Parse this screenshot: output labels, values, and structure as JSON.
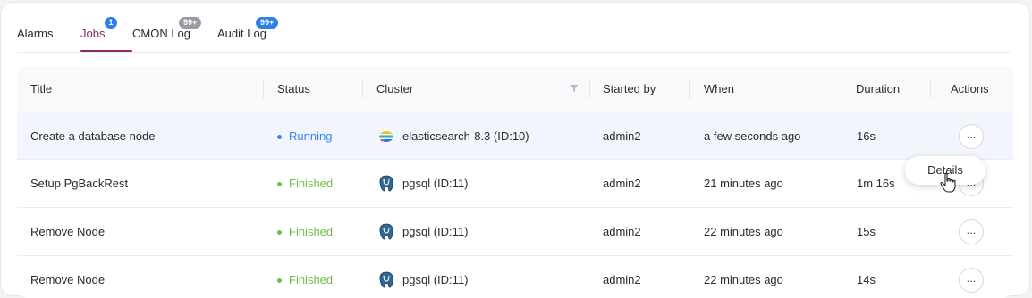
{
  "tabs": [
    {
      "label": "Alarms",
      "badge": ""
    },
    {
      "label": "Jobs",
      "badge": "1"
    },
    {
      "label": "CMON Log",
      "badge": "99+"
    },
    {
      "label": "Audit Log",
      "badge": "99+"
    }
  ],
  "colors": {
    "accent": "#8a2a63",
    "running": "#3b82f6",
    "finished": "#6cc04a",
    "badge_grey": "#9a9aa2",
    "badge_blue": "#2f7fe8"
  },
  "table": {
    "headers": {
      "title": "Title",
      "status": "Status",
      "cluster": "Cluster",
      "started_by": "Started by",
      "when": "When",
      "duration": "Duration",
      "actions": "Actions"
    },
    "rows": [
      {
        "title": "Create a database node",
        "status": "Running",
        "cluster": "elasticsearch-8.3 (ID:10)",
        "cluster_icon": "elasticsearch-icon",
        "started_by": "admin2",
        "when": "a few seconds ago",
        "duration": "16s",
        "action": "..."
      },
      {
        "title": "Setup PgBackRest",
        "status": "Finished",
        "cluster": "pgsql (ID:11)",
        "cluster_icon": "postgresql-icon",
        "started_by": "admin2",
        "when": "21 minutes ago",
        "duration": "1m 16s",
        "action": "..."
      },
      {
        "title": "Remove Node",
        "status": "Finished",
        "cluster": "pgsql (ID:11)",
        "cluster_icon": "postgresql-icon",
        "started_by": "admin2",
        "when": "22 minutes ago",
        "duration": "15s",
        "action": "..."
      },
      {
        "title": "Remove Node",
        "status": "Finished",
        "cluster": "pgsql (ID:11)",
        "cluster_icon": "postgresql-icon",
        "started_by": "admin2",
        "when": "22 minutes ago",
        "duration": "14s",
        "action": "..."
      }
    ]
  },
  "popover": {
    "details_label": "Details"
  }
}
